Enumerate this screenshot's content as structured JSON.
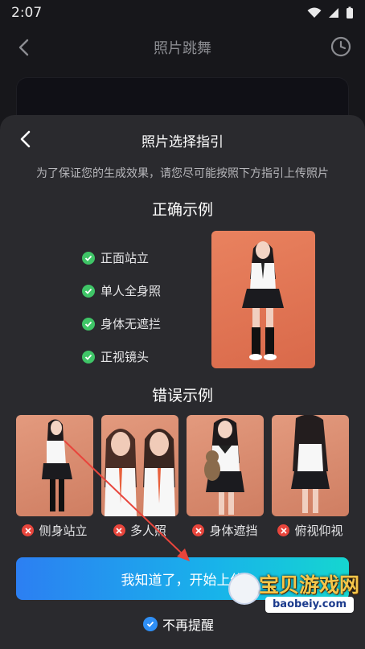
{
  "status_bar": {
    "time": "2:07"
  },
  "top_bar": {
    "title": "照片跳舞"
  },
  "sheet": {
    "title": "照片选择指引",
    "subtitle": "为了保证您的生成效果，请您尽可能按照下方指引上传照片",
    "correct": {
      "title": "正确示例",
      "items": [
        "正面站立",
        "单人全身照",
        "身体无遮拦",
        "正视镜头"
      ]
    },
    "wrong": {
      "title": "错误示例",
      "items": [
        "侧身站立",
        "多人照",
        "身体遮挡",
        "俯视仰视"
      ]
    },
    "cta_label": "我知道了，开始上传",
    "dont_remind_label": "不再提醒"
  },
  "watermark": {
    "text": "宝贝游戏网",
    "url": "baobeiy.com"
  },
  "colors": {
    "accent_check": "#3fc567",
    "error": "#e8453c",
    "cta_start": "#2c7ff2",
    "cta_end": "#15d6d0"
  }
}
